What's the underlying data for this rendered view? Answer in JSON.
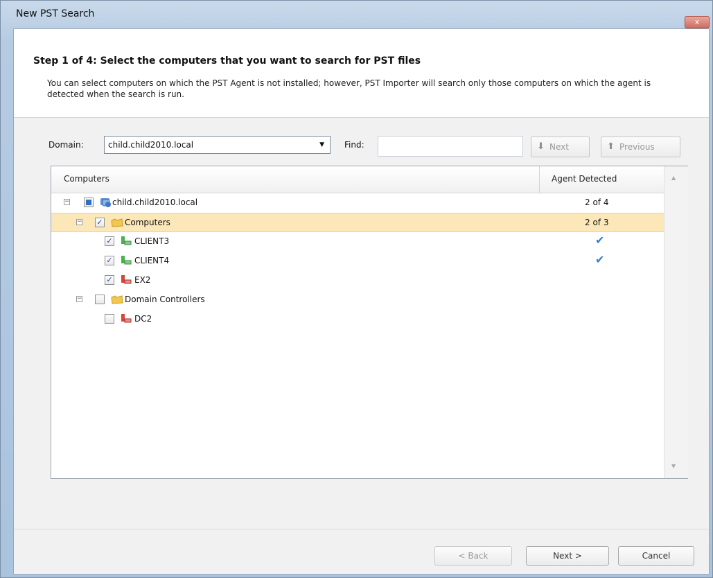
{
  "window": {
    "title": "New PST Search",
    "close_label": "x"
  },
  "header": {
    "step_title": "Step 1 of 4: Select the computers that you want to search for PST files",
    "description": "You can select computers on which the PST Agent is not installed; however, PST Importer will search only those computers on which the agent is detected when the search is run."
  },
  "toolbar": {
    "domain_label": "Domain:",
    "domain_value": "child.child2010.local",
    "find_label": "Find:",
    "find_value": "",
    "next_label": "Next",
    "previous_label": "Previous"
  },
  "grid": {
    "columns": [
      "Computers",
      "Agent Detected"
    ],
    "rows": [
      {
        "label": "child.child2010.local",
        "value": "2 of 4"
      },
      {
        "label": "Computers",
        "value": "2 of 3"
      },
      {
        "label": "CLIENT3",
        "value": ""
      },
      {
        "label": "CLIENT4",
        "value": ""
      },
      {
        "label": "EX2",
        "value": ""
      },
      {
        "label": "Domain Controllers",
        "value": ""
      },
      {
        "label": "DC2",
        "value": ""
      }
    ]
  },
  "footer": {
    "back_label": "< Back",
    "next_label": "Next >",
    "cancel_label": "Cancel"
  },
  "colors": {
    "selection": "#fbe7b8",
    "check": "#2f7ed8",
    "agent_ok": "#4caf50",
    "agent_missing": "#d9453b",
    "folder": "#f3c64d"
  }
}
